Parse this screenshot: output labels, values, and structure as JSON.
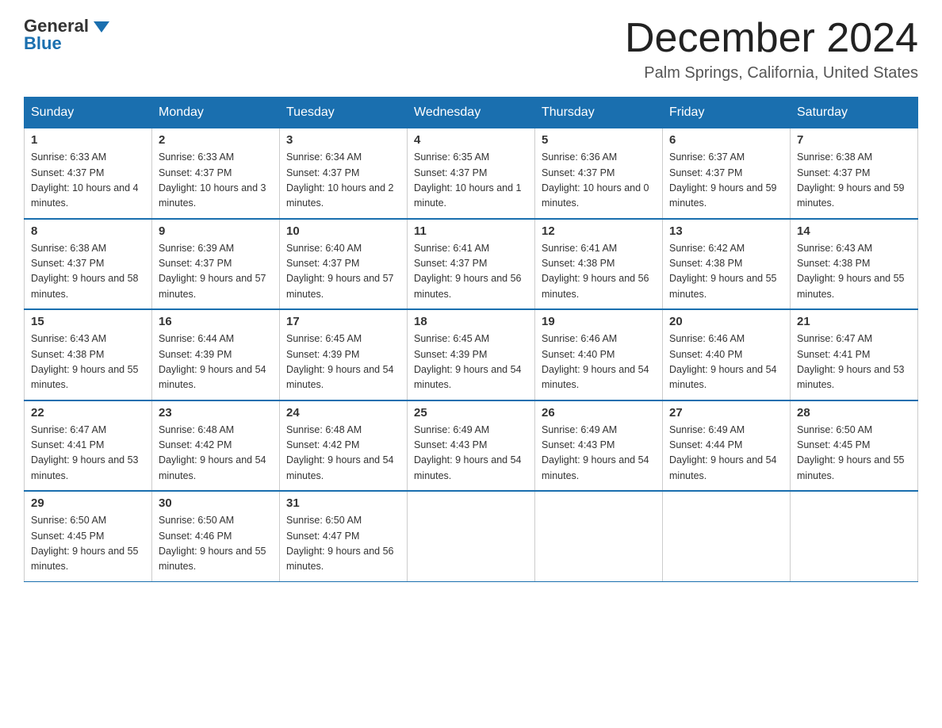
{
  "header": {
    "logo_general": "General",
    "logo_blue": "Blue",
    "month_title": "December 2024",
    "location": "Palm Springs, California, United States"
  },
  "weekdays": [
    "Sunday",
    "Monday",
    "Tuesday",
    "Wednesday",
    "Thursday",
    "Friday",
    "Saturday"
  ],
  "weeks": [
    [
      {
        "day": "1",
        "sunrise": "6:33 AM",
        "sunset": "4:37 PM",
        "daylight": "10 hours and 4 minutes."
      },
      {
        "day": "2",
        "sunrise": "6:33 AM",
        "sunset": "4:37 PM",
        "daylight": "10 hours and 3 minutes."
      },
      {
        "day": "3",
        "sunrise": "6:34 AM",
        "sunset": "4:37 PM",
        "daylight": "10 hours and 2 minutes."
      },
      {
        "day": "4",
        "sunrise": "6:35 AM",
        "sunset": "4:37 PM",
        "daylight": "10 hours and 1 minute."
      },
      {
        "day": "5",
        "sunrise": "6:36 AM",
        "sunset": "4:37 PM",
        "daylight": "10 hours and 0 minutes."
      },
      {
        "day": "6",
        "sunrise": "6:37 AM",
        "sunset": "4:37 PM",
        "daylight": "9 hours and 59 minutes."
      },
      {
        "day": "7",
        "sunrise": "6:38 AM",
        "sunset": "4:37 PM",
        "daylight": "9 hours and 59 minutes."
      }
    ],
    [
      {
        "day": "8",
        "sunrise": "6:38 AM",
        "sunset": "4:37 PM",
        "daylight": "9 hours and 58 minutes."
      },
      {
        "day": "9",
        "sunrise": "6:39 AM",
        "sunset": "4:37 PM",
        "daylight": "9 hours and 57 minutes."
      },
      {
        "day": "10",
        "sunrise": "6:40 AM",
        "sunset": "4:37 PM",
        "daylight": "9 hours and 57 minutes."
      },
      {
        "day": "11",
        "sunrise": "6:41 AM",
        "sunset": "4:37 PM",
        "daylight": "9 hours and 56 minutes."
      },
      {
        "day": "12",
        "sunrise": "6:41 AM",
        "sunset": "4:38 PM",
        "daylight": "9 hours and 56 minutes."
      },
      {
        "day": "13",
        "sunrise": "6:42 AM",
        "sunset": "4:38 PM",
        "daylight": "9 hours and 55 minutes."
      },
      {
        "day": "14",
        "sunrise": "6:43 AM",
        "sunset": "4:38 PM",
        "daylight": "9 hours and 55 minutes."
      }
    ],
    [
      {
        "day": "15",
        "sunrise": "6:43 AM",
        "sunset": "4:38 PM",
        "daylight": "9 hours and 55 minutes."
      },
      {
        "day": "16",
        "sunrise": "6:44 AM",
        "sunset": "4:39 PM",
        "daylight": "9 hours and 54 minutes."
      },
      {
        "day": "17",
        "sunrise": "6:45 AM",
        "sunset": "4:39 PM",
        "daylight": "9 hours and 54 minutes."
      },
      {
        "day": "18",
        "sunrise": "6:45 AM",
        "sunset": "4:39 PM",
        "daylight": "9 hours and 54 minutes."
      },
      {
        "day": "19",
        "sunrise": "6:46 AM",
        "sunset": "4:40 PM",
        "daylight": "9 hours and 54 minutes."
      },
      {
        "day": "20",
        "sunrise": "6:46 AM",
        "sunset": "4:40 PM",
        "daylight": "9 hours and 54 minutes."
      },
      {
        "day": "21",
        "sunrise": "6:47 AM",
        "sunset": "4:41 PM",
        "daylight": "9 hours and 53 minutes."
      }
    ],
    [
      {
        "day": "22",
        "sunrise": "6:47 AM",
        "sunset": "4:41 PM",
        "daylight": "9 hours and 53 minutes."
      },
      {
        "day": "23",
        "sunrise": "6:48 AM",
        "sunset": "4:42 PM",
        "daylight": "9 hours and 54 minutes."
      },
      {
        "day": "24",
        "sunrise": "6:48 AM",
        "sunset": "4:42 PM",
        "daylight": "9 hours and 54 minutes."
      },
      {
        "day": "25",
        "sunrise": "6:49 AM",
        "sunset": "4:43 PM",
        "daylight": "9 hours and 54 minutes."
      },
      {
        "day": "26",
        "sunrise": "6:49 AM",
        "sunset": "4:43 PM",
        "daylight": "9 hours and 54 minutes."
      },
      {
        "day": "27",
        "sunrise": "6:49 AM",
        "sunset": "4:44 PM",
        "daylight": "9 hours and 54 minutes."
      },
      {
        "day": "28",
        "sunrise": "6:50 AM",
        "sunset": "4:45 PM",
        "daylight": "9 hours and 55 minutes."
      }
    ],
    [
      {
        "day": "29",
        "sunrise": "6:50 AM",
        "sunset": "4:45 PM",
        "daylight": "9 hours and 55 minutes."
      },
      {
        "day": "30",
        "sunrise": "6:50 AM",
        "sunset": "4:46 PM",
        "daylight": "9 hours and 55 minutes."
      },
      {
        "day": "31",
        "sunrise": "6:50 AM",
        "sunset": "4:47 PM",
        "daylight": "9 hours and 56 minutes."
      },
      null,
      null,
      null,
      null
    ]
  ],
  "labels": {
    "sunrise": "Sunrise:",
    "sunset": "Sunset:",
    "daylight": "Daylight:"
  }
}
